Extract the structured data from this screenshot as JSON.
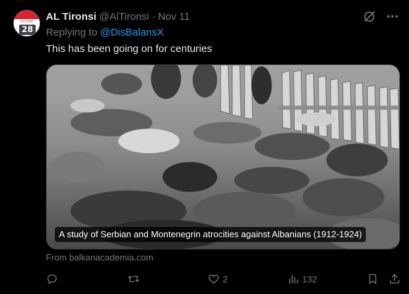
{
  "avatar": {
    "top_word": "Unite",
    "number": "28"
  },
  "author": {
    "name": "AL Tironsi",
    "handle": "@AlTironsi",
    "separator": "·",
    "date": "Nov 11"
  },
  "reply": {
    "prefix": "Replying to",
    "mention": "@DisBalansX"
  },
  "text": "This has been going on for centuries",
  "media": {
    "caption": "A study of Serbian and Montenegrin atrocities against Albanians (1912-1924)"
  },
  "source": "From balkanacademia.com",
  "actions": {
    "reply_count": "",
    "repost_count": "",
    "like_count": "2",
    "views_count": "132"
  },
  "icons": [
    "grok-icon",
    "more-icon",
    "reply-icon",
    "repost-icon",
    "like-icon",
    "views-icon",
    "bookmark-icon",
    "share-icon"
  ]
}
